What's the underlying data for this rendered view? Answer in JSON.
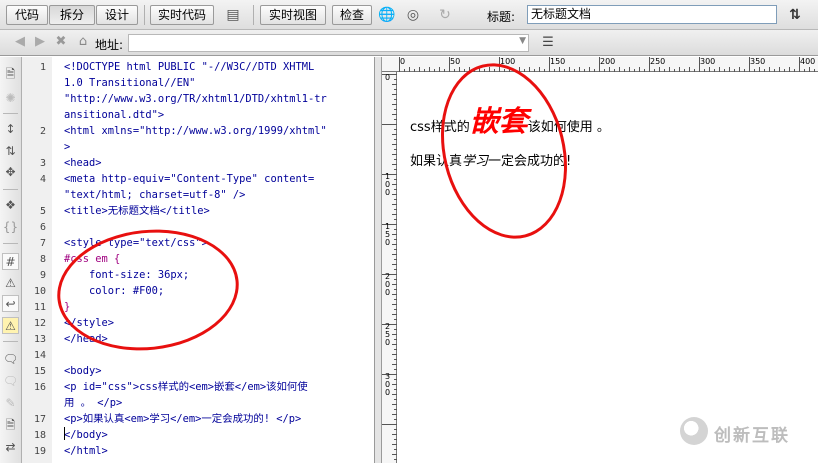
{
  "toolbar": {
    "code_btn": "代码",
    "split_btn": "拆分",
    "design_btn": "设计",
    "live_code_btn": "实时代码",
    "live_view_btn": "实时视图",
    "inspect_btn": "检查",
    "title_label": "标题:",
    "title_value": "无标题文档"
  },
  "address_bar": {
    "label": "地址:",
    "value": ""
  },
  "code": {
    "line_numbers": [
      "1",
      "",
      "",
      "",
      "2",
      "",
      "3",
      "4",
      "",
      "5",
      "6",
      "7",
      "8",
      "9",
      "10",
      "11",
      "12",
      "13",
      "14",
      "15",
      "16",
      "",
      "17",
      "18",
      "19"
    ],
    "lines": [
      "<!DOCTYPE html PUBLIC \"-//W3C//DTD XHTML",
      "1.0 Transitional//EN\"",
      "\"http://www.w3.org/TR/xhtml1/DTD/xhtml1-tr",
      "ansitional.dtd\">",
      "<html xmlns=\"http://www.w3.org/1999/xhtml\"",
      ">",
      "<head>",
      "<meta http-equiv=\"Content-Type\" content=",
      "\"text/html; charset=utf-8\" />",
      "<title>无标题文档</title>",
      "",
      "<style type=\"text/css\">",
      "#css em {",
      "    font-size: 36px;",
      "    color: #F00;",
      "}",
      "</style>",
      "</head>",
      "",
      "<body>",
      "<p id=\"css\">css样式的<em>嵌套</em>该如何使",
      "用 。 </p>",
      "<p>如果认真<em>学习</em>一定会成功的! </p>",
      "</body>",
      "</html>"
    ]
  },
  "design": {
    "ruler_h": [
      "0",
      "50",
      "100",
      "150",
      "200",
      "250",
      "300",
      "350",
      "400"
    ],
    "ruler_v": [
      "0",
      "50",
      "100",
      "150",
      "200",
      "250",
      "300"
    ],
    "para1_before": "css样式的",
    "para1_em": "嵌套",
    "para1_after": "该如何使用 。",
    "para2_before": "如果认真",
    "para2_em": "学习",
    "para2_after": "一定会成功的!"
  },
  "watermark": "创新互联",
  "colors": {
    "annotation": "#e8100f",
    "em_text": "#ff0000",
    "code_tag": "#000099",
    "css_selector": "#a00080"
  }
}
